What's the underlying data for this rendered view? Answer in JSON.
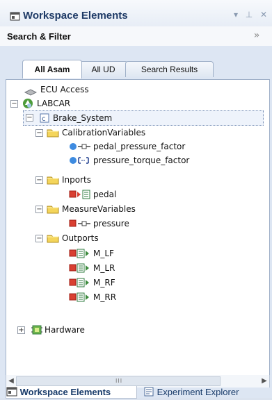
{
  "window": {
    "title": "Workspace Elements"
  },
  "search": {
    "title": "Search & Filter"
  },
  "tabs": [
    {
      "label": "All Asam"
    },
    {
      "label": "All UD"
    },
    {
      "label": "Search Results"
    }
  ],
  "tree": {
    "items": [
      {
        "label": "ECU Access",
        "icon": "ecu-access-icon"
      },
      {
        "label": "LABCAR",
        "icon": "labcar-icon"
      },
      {
        "label": "Brake_System",
        "icon": "component-icon"
      },
      {
        "label": "CalibrationVariables",
        "icon": "folder-icon"
      },
      {
        "label": "pedal_pressure_factor",
        "icon": "calibration-variable-icon"
      },
      {
        "label": "pressure_torque_factor",
        "icon": "calibration-variable-icon"
      },
      {
        "label": "Inports",
        "icon": "folder-icon"
      },
      {
        "label": "pedal",
        "icon": "inport-icon"
      },
      {
        "label": "MeasureVariables",
        "icon": "folder-icon"
      },
      {
        "label": "pressure",
        "icon": "measure-variable-icon"
      },
      {
        "label": "Outports",
        "icon": "folder-icon"
      },
      {
        "label": "M_LF",
        "icon": "outport-icon"
      },
      {
        "label": "M_LR",
        "icon": "outport-icon"
      },
      {
        "label": "M_RF",
        "icon": "outport-icon"
      },
      {
        "label": "M_RR",
        "icon": "outport-icon"
      },
      {
        "label": "Hardware",
        "icon": "hardware-icon"
      }
    ]
  },
  "scroll": {
    "grip": "III"
  },
  "bottom_tabs": [
    {
      "label": "Workspace Elements"
    },
    {
      "label": "Experiment Explorer"
    }
  ],
  "colors": {
    "accent": "#173a69",
    "selection_border": "#738bb3",
    "folder": "#e8c13d",
    "outport": "#d93f31",
    "calibration": "#3e8be0"
  }
}
